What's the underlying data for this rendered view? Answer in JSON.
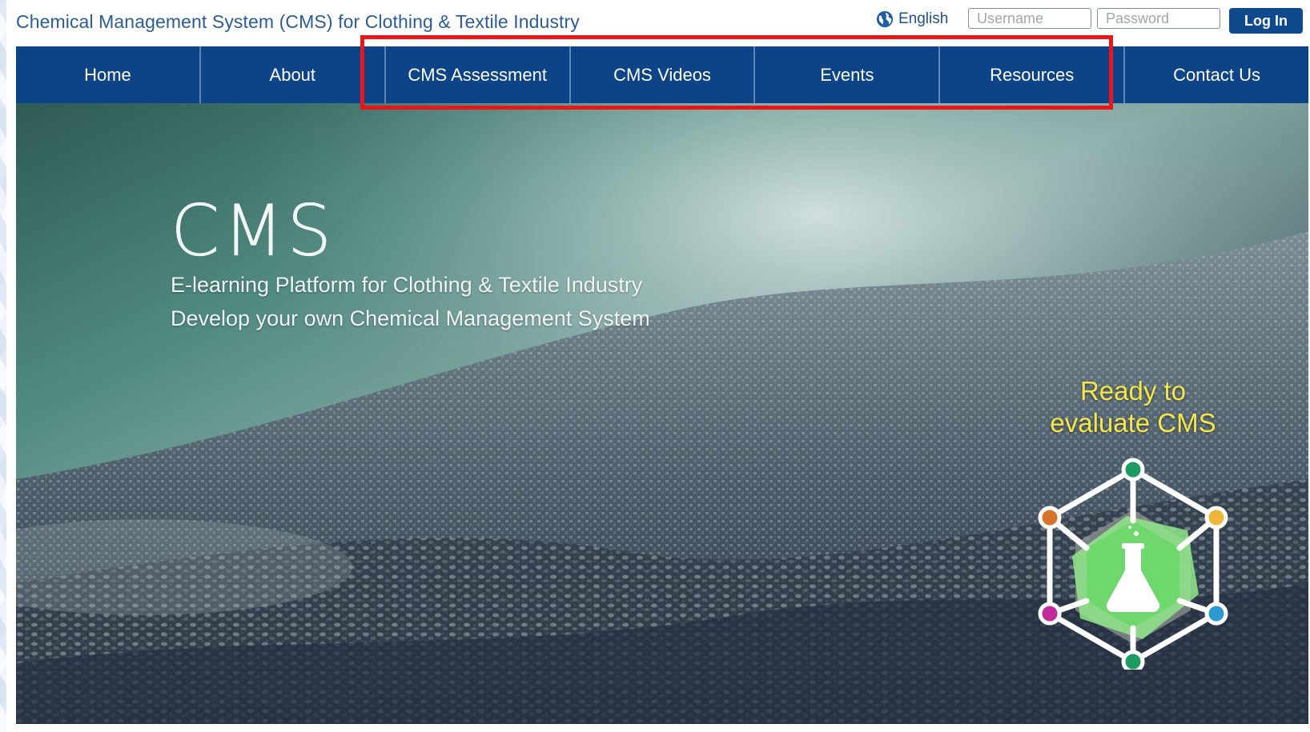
{
  "header": {
    "site_title": "Chemical Management System (CMS) for Clothing & Textile Industry",
    "language_label": "English",
    "username_placeholder": "Username",
    "password_placeholder": "Password",
    "login_label": "Log In"
  },
  "nav": {
    "items": [
      {
        "label": "Home"
      },
      {
        "label": "About"
      },
      {
        "label": "CMS Assessment"
      },
      {
        "label": "CMS Videos"
      },
      {
        "label": "Events"
      },
      {
        "label": "Resources"
      },
      {
        "label": "Contact Us"
      }
    ]
  },
  "hero": {
    "title": "CMS",
    "subtitle_line1": "E-learning Platform for Clothing & Textile Industry",
    "subtitle_line2": "Develop your own Chemical Management System",
    "cta_line1": "Ready to",
    "cta_line2": "evaluate CMS"
  },
  "icons": {
    "language": "globe-icon",
    "cta": "flask-hexagon-icon"
  },
  "colors": {
    "nav_background": "#0d4487",
    "title_text": "#2a5d98",
    "highlight_border": "#e8161a",
    "cta_text": "#f5e64a",
    "login_button": "#0f4a8c"
  }
}
